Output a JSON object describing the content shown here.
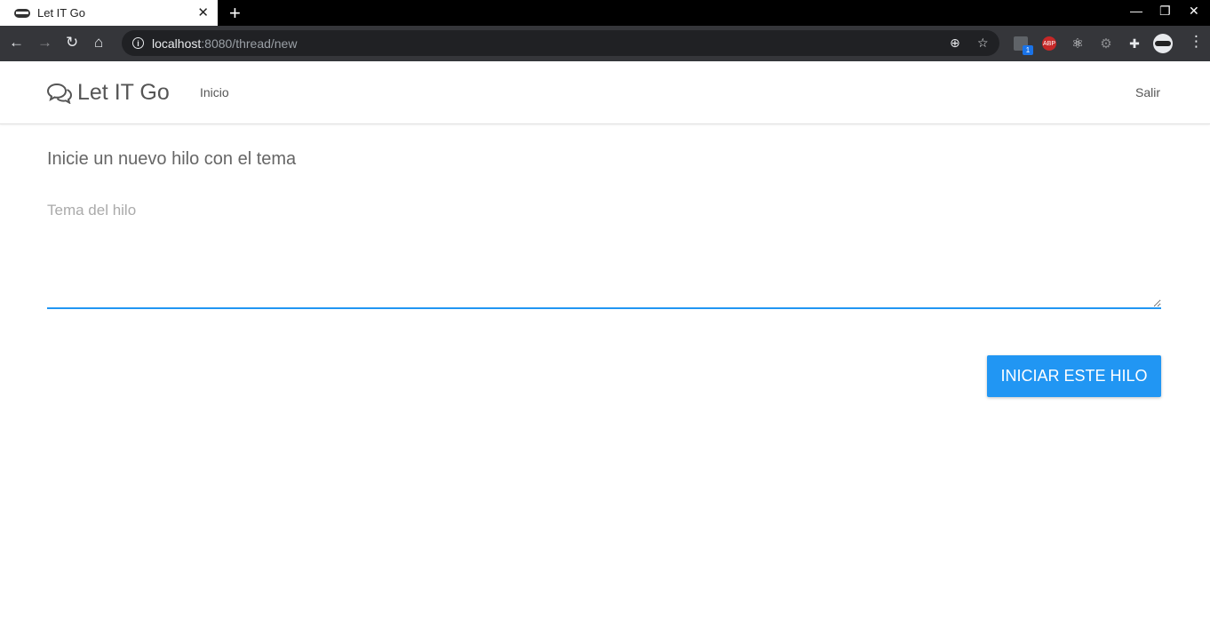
{
  "browser": {
    "tab_title": "Let IT Go",
    "url_host": "localhost",
    "url_path": ":8080/thread/new",
    "extension_badge": "1",
    "abp_label": "ABP"
  },
  "app": {
    "brand": "Let IT Go",
    "nav_home": "Inicio",
    "nav_logout": "Salir"
  },
  "form": {
    "heading": "Inicie un nuevo hilo con el tema",
    "topic_placeholder": "Tema del hilo",
    "topic_value": "",
    "submit_label": "INICIAR ESTE HILO"
  },
  "colors": {
    "accent": "#2196f3",
    "tabbar": "#000000",
    "toolbar": "#35363a"
  }
}
